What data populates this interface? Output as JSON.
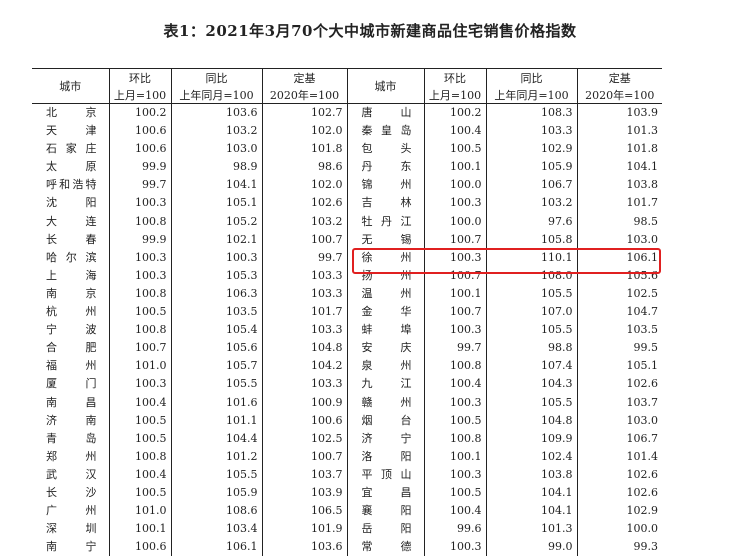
{
  "title": "表1：2021年3月70个大中城市新建商品住宅销售价格指数",
  "headers": {
    "city": "城市",
    "mom": "环比",
    "yoy": "同比",
    "base": "定基",
    "mom_sub": "上月=100",
    "yoy_sub": "上年同月=100",
    "base_sub": "2020年=100"
  },
  "rows": [
    {
      "l": [
        "北京",
        "100.2",
        "103.6",
        "102.7"
      ],
      "r": [
        "唐山",
        "100.2",
        "108.3",
        "103.9"
      ]
    },
    {
      "l": [
        "天津",
        "100.6",
        "103.2",
        "102.0"
      ],
      "r": [
        "秦皇岛",
        "100.4",
        "103.3",
        "101.3"
      ]
    },
    {
      "l": [
        "石家庄",
        "100.6",
        "103.0",
        "101.8"
      ],
      "r": [
        "包头",
        "100.5",
        "102.9",
        "101.8"
      ]
    },
    {
      "l": [
        "太原",
        "99.9",
        "98.9",
        "98.6"
      ],
      "r": [
        "丹东",
        "100.1",
        "105.9",
        "104.1"
      ]
    },
    {
      "l": [
        "呼和浩特",
        "99.7",
        "104.1",
        "102.0"
      ],
      "r": [
        "锦州",
        "100.0",
        "106.7",
        "103.8"
      ]
    },
    {
      "l": [
        "沈阳",
        "100.3",
        "105.1",
        "102.6"
      ],
      "r": [
        "吉林",
        "100.3",
        "103.2",
        "101.7"
      ]
    },
    {
      "l": [
        "大连",
        "100.8",
        "105.2",
        "103.2"
      ],
      "r": [
        "牡丹江",
        "100.0",
        "97.6",
        "98.5"
      ]
    },
    {
      "l": [
        "长春",
        "99.9",
        "102.1",
        "100.7"
      ],
      "r": [
        "无锡",
        "100.7",
        "105.8",
        "103.0"
      ]
    },
    {
      "l": [
        "哈尔滨",
        "100.3",
        "100.3",
        "99.7"
      ],
      "r": [
        "徐州",
        "100.3",
        "110.1",
        "106.1"
      ]
    },
    {
      "l": [
        "上海",
        "100.3",
        "105.3",
        "103.3"
      ],
      "r": [
        "扬州",
        "100.7",
        "108.0",
        "105.6"
      ]
    },
    {
      "l": [
        "南京",
        "100.8",
        "106.3",
        "103.3"
      ],
      "r": [
        "温州",
        "100.1",
        "105.5",
        "102.5"
      ]
    },
    {
      "l": [
        "杭州",
        "100.5",
        "103.5",
        "101.7"
      ],
      "r": [
        "金华",
        "100.7",
        "107.0",
        "104.7"
      ]
    },
    {
      "l": [
        "宁波",
        "100.8",
        "105.4",
        "103.3"
      ],
      "r": [
        "蚌埠",
        "100.3",
        "105.5",
        "103.5"
      ]
    },
    {
      "l": [
        "合肥",
        "100.7",
        "105.6",
        "104.8"
      ],
      "r": [
        "安庆",
        "99.7",
        "98.8",
        "99.5"
      ]
    },
    {
      "l": [
        "福州",
        "101.0",
        "105.7",
        "104.2"
      ],
      "r": [
        "泉州",
        "100.8",
        "107.4",
        "105.1"
      ]
    },
    {
      "l": [
        "厦门",
        "100.3",
        "105.5",
        "103.3"
      ],
      "r": [
        "九江",
        "100.4",
        "104.3",
        "102.6"
      ]
    },
    {
      "l": [
        "南昌",
        "100.4",
        "101.6",
        "100.9"
      ],
      "r": [
        "赣州",
        "100.3",
        "105.5",
        "103.7"
      ]
    },
    {
      "l": [
        "济南",
        "100.5",
        "101.1",
        "100.6"
      ],
      "r": [
        "烟台",
        "100.5",
        "104.8",
        "103.0"
      ]
    },
    {
      "l": [
        "青岛",
        "100.5",
        "104.4",
        "102.5"
      ],
      "r": [
        "济宁",
        "100.8",
        "109.9",
        "106.7"
      ]
    },
    {
      "l": [
        "郑州",
        "100.8",
        "101.2",
        "100.7"
      ],
      "r": [
        "洛阳",
        "100.1",
        "102.4",
        "101.4"
      ]
    },
    {
      "l": [
        "武汉",
        "100.4",
        "105.5",
        "103.7"
      ],
      "r": [
        "平顶山",
        "100.3",
        "103.8",
        "102.6"
      ]
    },
    {
      "l": [
        "长沙",
        "100.5",
        "105.9",
        "103.9"
      ],
      "r": [
        "宜昌",
        "100.5",
        "104.1",
        "102.6"
      ]
    },
    {
      "l": [
        "广州",
        "101.0",
        "108.6",
        "106.5"
      ],
      "r": [
        "襄阳",
        "100.4",
        "104.1",
        "102.9"
      ]
    },
    {
      "l": [
        "深圳",
        "100.1",
        "103.4",
        "101.9"
      ],
      "r": [
        "岳阳",
        "99.6",
        "101.3",
        "100.0"
      ]
    },
    {
      "l": [
        "南宁",
        "100.6",
        "106.1",
        "103.6"
      ],
      "r": [
        "常德",
        "100.3",
        "99.0",
        "99.3"
      ]
    }
  ],
  "highlight": {
    "row": "徐州",
    "color": "#e02020"
  }
}
